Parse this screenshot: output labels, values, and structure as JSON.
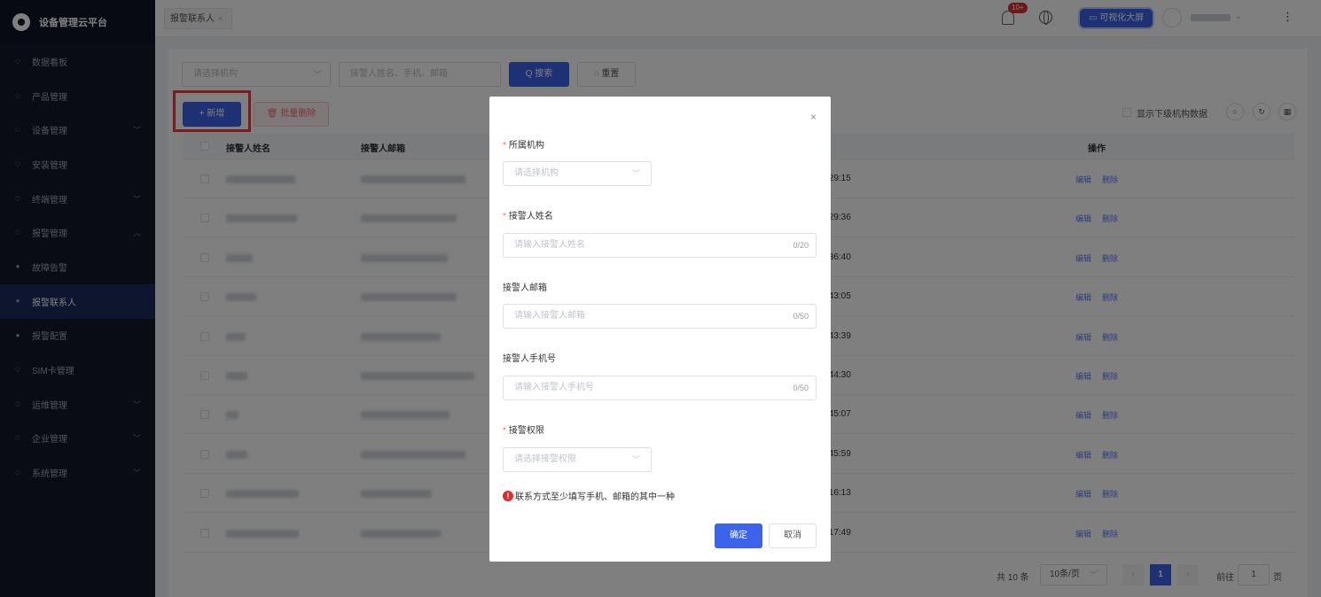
{
  "sidebar": {
    "brand": "设备管理云平台",
    "items": [
      {
        "label": "数据看板",
        "icon": "chart-icon",
        "has_arrow": false
      },
      {
        "label": "产品管理",
        "icon": "cube-icon",
        "has_arrow": false
      },
      {
        "label": "设备管理",
        "icon": "device-icon",
        "has_arrow": true,
        "arrow": "﹀"
      },
      {
        "label": "安装管理",
        "icon": "install-icon",
        "has_arrow": false
      },
      {
        "label": "终端管理",
        "icon": "user-icon",
        "has_arrow": true,
        "arrow": "﹀"
      },
      {
        "label": "报警管理",
        "icon": "alarm-icon",
        "has_arrow": true,
        "arrow": "︿"
      },
      {
        "label": "故障告警",
        "sub": true
      },
      {
        "label": "报警联系人",
        "sub": true,
        "active": true
      },
      {
        "label": "报警配置",
        "sub": true
      },
      {
        "label": "SIM卡管理",
        "icon": "sim-icon",
        "has_arrow": false
      },
      {
        "label": "运维管理",
        "icon": "ops-icon",
        "has_arrow": true,
        "arrow": "﹀"
      },
      {
        "label": "企业管理",
        "icon": "company-icon",
        "has_arrow": true,
        "arrow": "﹀"
      },
      {
        "label": "系统管理",
        "icon": "settings-icon",
        "has_arrow": true,
        "arrow": "﹀"
      }
    ]
  },
  "topbar": {
    "tab_label": "报警联系人",
    "tab_close": "×",
    "notify_badge": "10+",
    "bigscreen_label": "可视化大屏",
    "kebab": "⋮"
  },
  "filters": {
    "org_placeholder": "请选择机构",
    "search_placeholder": "接警人姓名、手机、邮箱",
    "search_label": "Q 搜索",
    "reset_label": "◌ 重置"
  },
  "toolbar": {
    "add_label": "+ 新增",
    "batch_delete_label": "批量删除",
    "show_sub_label": "显示下级机构数据"
  },
  "table": {
    "headers": {
      "name": "接警人姓名",
      "email": "接警人邮箱",
      "ops": "操作"
    },
    "rows": [
      {
        "time": ":29:15",
        "edit": "编辑",
        "del": "删除"
      },
      {
        "time": ":29:36",
        "edit": "编辑",
        "del": "删除"
      },
      {
        "time": ":36:40",
        "edit": "编辑",
        "del": "删除"
      },
      {
        "time": ":43:05",
        "edit": "编辑",
        "del": "删除"
      },
      {
        "time": ":43:39",
        "edit": "编辑",
        "del": "删除"
      },
      {
        "time": ":44:30",
        "edit": "编辑",
        "del": "删除"
      },
      {
        "time": ":45:07",
        "edit": "编辑",
        "del": "删除"
      },
      {
        "time": ":45:59",
        "edit": "编辑",
        "del": "删除"
      },
      {
        "time": ":16:13",
        "edit": "编辑",
        "del": "删除"
      },
      {
        "time": ":17:49",
        "edit": "编辑",
        "del": "删除"
      }
    ]
  },
  "pagination": {
    "total": "共 10 条",
    "page_size": "10条/页",
    "current": "1",
    "goto_prefix": "前往",
    "goto_value": "1",
    "goto_suffix": "页"
  },
  "dialog": {
    "close": "×",
    "org_label": "所属机构",
    "org_placeholder": "请选择机构",
    "name_label": "接警人姓名",
    "name_placeholder": "请输入接警人姓名",
    "name_count": "0/20",
    "email_label": "接警人邮箱",
    "email_placeholder": "请输入接警人邮箱",
    "email_count": "0/50",
    "phone_label": "接警人手机号",
    "phone_placeholder": "请输入接警人手机号",
    "phone_count": "0/50",
    "perm_label": "接警权限",
    "perm_placeholder": "请选择接警权限",
    "warning": "联系方式至少填写手机、邮箱的其中一种",
    "confirm_label": "确定",
    "cancel_label": "取消"
  },
  "colors": {
    "primary": "#3c63eb",
    "danger": "#f56c6c",
    "sidebar_bg": "#12162b",
    "highlight_box": "#ef3b3b"
  }
}
